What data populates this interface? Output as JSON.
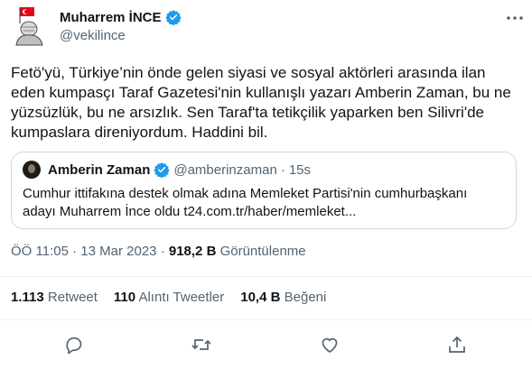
{
  "author": {
    "display_name": "Muharrem İNCE",
    "handle": "@vekilince",
    "avatar_icon": "seal-avatar-icon",
    "verified_icon": "verified-badge-icon"
  },
  "tweet": {
    "text": "Fetö'yü, Türkiye’nin önde gelen siyasi ve sosyal aktörleri arasında ilan eden kumpasçı Taraf Gazetesi'nin kullanışlı yazarı Amberin Zaman, bu ne yüzsüzlük, bu ne arsızlık. Sen Taraf'ta tetikçilik yaparken ben Silivri'de kumpaslara direniyordum. Haddini bil."
  },
  "quote": {
    "display_name": "Amberin Zaman",
    "handle": "@amberinzaman",
    "separator": "·",
    "time": "15s",
    "text": "Cumhur ittifakına destek olmak adına Memleket Partisi'nin cumhurbaşkanı adayı Muharrem İnce oldu t24.com.tr/haber/memleket..."
  },
  "meta": {
    "time": "ÖÖ 11:05",
    "sep1": "·",
    "date": "13 Mar 2023",
    "sep2": "·",
    "views_count": "918,2 B",
    "views_label": "Görüntülenme"
  },
  "stats": {
    "retweets_count": "1.113",
    "retweets_label": "Retweet",
    "quotes_count": "110",
    "quotes_label": "Alıntı Tweetler",
    "likes_count": "10,4 B",
    "likes_label": "Beğeni"
  },
  "colors": {
    "text_primary": "#0f1419",
    "text_secondary": "#536471",
    "verified_blue": "#1d9bf0",
    "border": "#cfd9de"
  }
}
